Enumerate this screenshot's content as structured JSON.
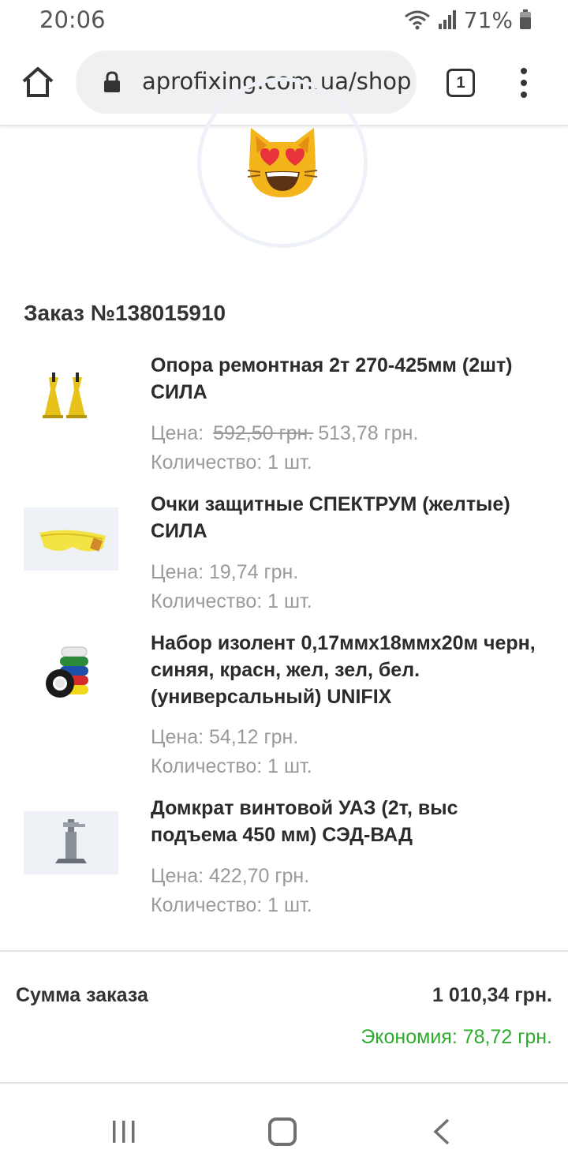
{
  "status": {
    "time": "20:06",
    "battery_percent": "71%"
  },
  "browser": {
    "url": "aprofixing.com.ua/shop",
    "tab_count": "1"
  },
  "order": {
    "title": "Заказ №138015910",
    "items": [
      {
        "name": "Опора ремонтная 2т 270-425мм (2шт) СИЛА",
        "price_label": "Цена:",
        "old_price": "592,50 грн.",
        "price": "513,78 грн.",
        "qty": "Количество: 1 шт.",
        "thumb_icon": "jack-stands-image"
      },
      {
        "name": "Очки защитные СПЕКТРУМ (желтые) СИЛА",
        "price": "Цена: 19,74 грн.",
        "qty": "Количество: 1 шт.",
        "thumb_icon": "safety-glasses-image"
      },
      {
        "name": "Набор изолент 0,17ммх18ммх20м черн, синяя, красн, жел, зел, бел. (универсальный) UNIFIX",
        "price": "Цена: 54,12 грн.",
        "qty": "Количество: 1 шт.",
        "thumb_icon": "tape-rolls-image"
      },
      {
        "name": "Домкрат винтовой УАЗ (2т, выс подъема 450 мм) СЭД-ВАД",
        "price": "Цена: 422,70 грн.",
        "qty": "Количество: 1 шт.",
        "thumb_icon": "screw-jack-image"
      }
    ],
    "sum_label": "Сумма заказа",
    "sum_value": "1 010,34 грн.",
    "savings": "Экономия: 78,72 грн."
  },
  "colors": {
    "savings": "#2eab2e",
    "text": "#333333",
    "muted": "#9a9a9a"
  }
}
